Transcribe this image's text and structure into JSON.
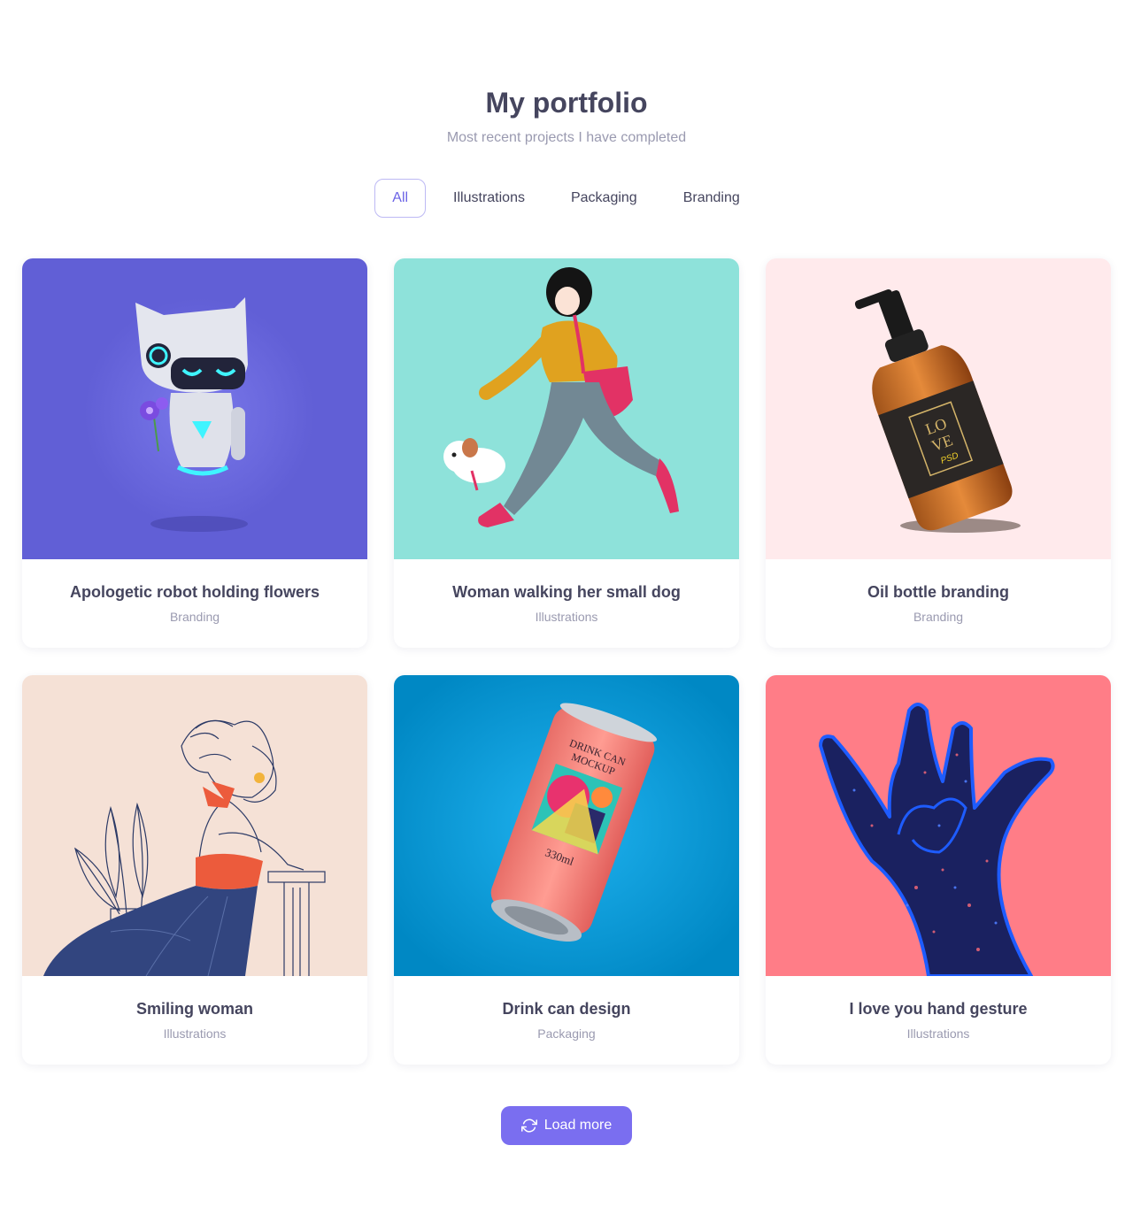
{
  "header": {
    "title": "My portfolio",
    "subtitle": "Most recent projects I have completed"
  },
  "filters": [
    {
      "label": "All",
      "active": true
    },
    {
      "label": "Illustrations",
      "active": false
    },
    {
      "label": "Packaging",
      "active": false
    },
    {
      "label": "Branding",
      "active": false
    }
  ],
  "projects": [
    {
      "title": "Apologetic robot holding flowers",
      "category": "Branding",
      "bg": "#615fd6"
    },
    {
      "title": "Woman walking her small dog",
      "category": "Illustrations",
      "bg": "#8ee2da"
    },
    {
      "title": "Oil bottle branding",
      "category": "Branding",
      "bg": "#ffeaec"
    },
    {
      "title": "Smiling woman",
      "category": "Illustrations",
      "bg": "#f5e1d6"
    },
    {
      "title": "Drink can design",
      "category": "Packaging",
      "bg": "#0596d3"
    },
    {
      "title": "I love you hand gesture",
      "category": "Illustrations",
      "bg": "#ff7d87"
    }
  ],
  "product_text": {
    "bottle_label_line1": "LO",
    "bottle_label_line2": "VE",
    "bottle_label_line3": "PSD",
    "can_label_line1": "DRINK CAN",
    "can_label_line2": "MOCKUP",
    "can_volume": "330ml"
  },
  "load_more": {
    "label": "Load more",
    "icon": "refresh-icon"
  },
  "colors": {
    "accent": "#7a6ef0",
    "active_filter": "#6b63e6",
    "heading": "#45455e",
    "muted": "#9a9ab0"
  }
}
